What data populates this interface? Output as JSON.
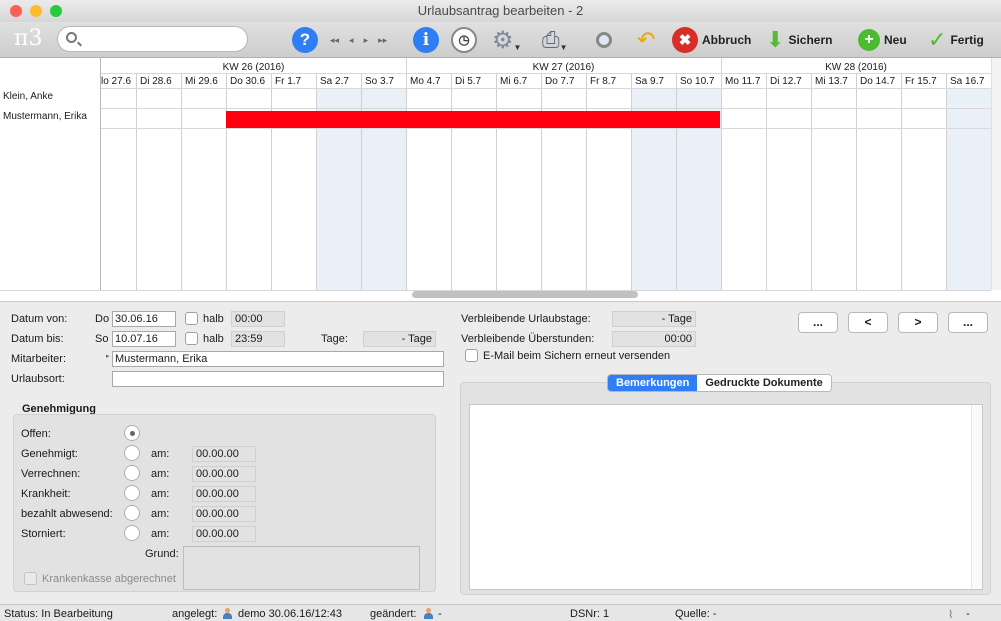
{
  "window": {
    "title": "Urlaubsantrag bearbeiten - 2"
  },
  "toolbar": {
    "logo": "π3",
    "search_placeholder": "",
    "abbruch": "Abbruch",
    "sichern": "Sichern",
    "neu": "Neu",
    "fertig": "Fertig"
  },
  "calendar": {
    "weeks": [
      "KW 26 (2016)",
      "KW 27 (2016)",
      "KW 28 (2016)"
    ],
    "days": [
      "lo 27.6",
      "Di 28.6",
      "Mi 29.6",
      "Do 30.6",
      "Fr 1.7",
      "Sa 2.7",
      "So 3.7",
      "Mo 4.7",
      "Di 5.7",
      "Mi 6.7",
      "Do 7.7",
      "Fr 8.7",
      "Sa 9.7",
      "So 10.7",
      "Mo 11.7",
      "Di 12.7",
      "Mi 13.7",
      "Do 14.7",
      "Fr 15.7",
      "Sa 16.7"
    ],
    "people": [
      "Klein, Anke",
      "Mustermann, Erika"
    ]
  },
  "form": {
    "datum_von_label": "Datum von:",
    "datum_von_day": "Do",
    "datum_von": "30.06.16",
    "halb1": "halb",
    "time_von": "00:00",
    "datum_bis_label": "Datum bis:",
    "datum_bis_day": "So",
    "datum_bis": "10.07.16",
    "halb2": "halb",
    "time_bis": "23:59",
    "tage_label": "Tage:",
    "tage_value": "- Tage",
    "mitarbeiter_label": "Mitarbeiter:",
    "mitarbeiter": "Mustermann, Erika",
    "urlaubsort_label": "Urlaubsort:",
    "urlaubsort": "",
    "verbl_tage_label": "Verbleibende Urlaubstage:",
    "verbl_tage": "- Tage",
    "verbl_stunden_label": "Verbleibende Überstunden:",
    "verbl_stunden": "00:00",
    "email_label": "E-Mail beim Sichern erneut versenden"
  },
  "nav": {
    "first": "...",
    "prev": "<",
    "next": ">",
    "last": "..."
  },
  "genehmigung": {
    "title": "Genehmigung",
    "offen": "Offen:",
    "rows": [
      {
        "label": "Genehmigt:",
        "am": "am:",
        "date": "00.00.00"
      },
      {
        "label": "Verrechnen:",
        "am": "am:",
        "date": "00.00.00"
      },
      {
        "label": "Krankheit:",
        "am": "am:",
        "date": "00.00.00"
      },
      {
        "label": "bezahlt abwesend:",
        "am": "am:",
        "date": "00.00.00"
      },
      {
        "label": "Storniert:",
        "am": "am:",
        "date": "00.00.00"
      }
    ],
    "grund_label": "Grund:",
    "krankenkasse_label": "Krankenkasse abgerechnet"
  },
  "tabs": {
    "bemerkungen": "Bemerkungen",
    "dokumente": "Gedruckte Dokumente"
  },
  "status": {
    "status": "Status:  In Bearbeitung",
    "angelegt_label": "angelegt:",
    "angelegt": "demo 30.06.16/12:43",
    "geaendert_label": "geändert:",
    "geaendert": "-",
    "dsnr": "DSNr: 1",
    "quelle": "Quelle: -",
    "attach": "-"
  },
  "colors": {
    "accent": "#2f7ef5",
    "bar": "#ff0010",
    "weekend": "#eaf0f8"
  }
}
